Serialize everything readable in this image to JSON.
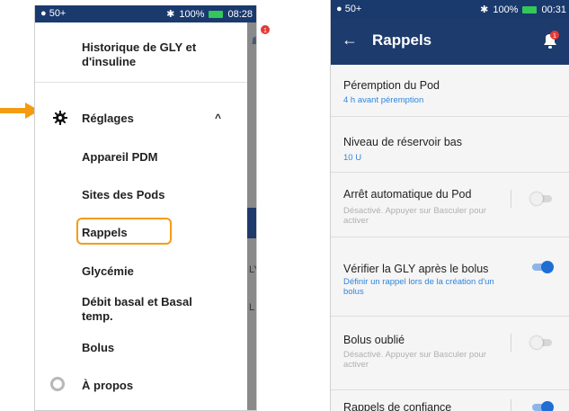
{
  "left_screen": {
    "status": {
      "signal": "● 50+",
      "battery": "100%",
      "time": "08:28",
      "bluetooth": "✱"
    },
    "notification_badge": "1",
    "drawer": {
      "history_label": "Historique de GLY et\nd'insuline",
      "settings_label": "Réglages",
      "items": [
        {
          "label": "Appareil PDM"
        },
        {
          "label": "Sites des Pods"
        },
        {
          "label": "Rappels"
        },
        {
          "label": "Glycémie"
        },
        {
          "label": "Débit basal et Basal\ntemp."
        },
        {
          "label": "Bolus"
        }
      ],
      "about_label": "À propos"
    },
    "behind_text": [
      "LY",
      "L"
    ]
  },
  "right_screen": {
    "status": {
      "signal": "● 50+",
      "battery": "100%",
      "time": "00:31",
      "bluetooth": "✱"
    },
    "title": "Rappels",
    "back": "←",
    "notification_badge": "1",
    "rows": [
      {
        "title": "Péremption du Pod",
        "subtitle": "4 h avant péremption",
        "sub_color": "blue"
      },
      {
        "title": "Niveau de réservoir bas",
        "subtitle": "10 U",
        "sub_color": "blue"
      },
      {
        "title": "Arrêt automatique du Pod",
        "subtitle": "Désactivé. Appuyer sur Basculer pour activer",
        "sub_color": "grey",
        "toggle": "off"
      },
      {
        "title": "Vérifier la GLY après le bolus",
        "subtitle": "Définir un rappel lors de la création d'un bolus",
        "sub_color": "blue",
        "toggle": "on"
      },
      {
        "title": "Bolus oublié",
        "subtitle": "Désactivé. Appuyer sur Basculer pour activer",
        "sub_color": "grey",
        "toggle": "off"
      },
      {
        "title": "Rappels de confiance",
        "subtitle": "",
        "toggle": "on"
      }
    ]
  },
  "colors": {
    "primary": "#1d3b6d",
    "accent": "#1f6ed4",
    "highlight": "#f39c12",
    "link": "#2e86de"
  }
}
